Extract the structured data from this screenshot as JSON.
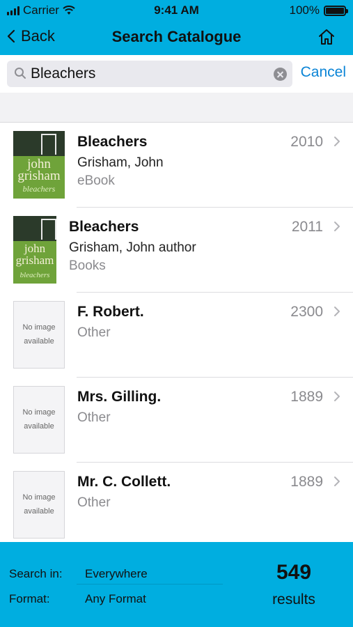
{
  "status_bar": {
    "carrier": "Carrier",
    "time": "9:41 AM",
    "battery": "100%",
    "icons": [
      "signal-icon",
      "wifi-icon",
      "battery-icon"
    ]
  },
  "nav": {
    "back_label": "Back",
    "title": "Search Catalogue",
    "icons": [
      "chevron-left-icon",
      "home-icon"
    ]
  },
  "search": {
    "query": "Bleachers",
    "cancel_label": "Cancel",
    "icons": [
      "search-icon",
      "clear-icon"
    ]
  },
  "results": [
    {
      "title": "Bleachers",
      "author": "Grisham, John",
      "format": "eBook",
      "year": "2010",
      "cover": {
        "type": "image",
        "lines": [
          "john",
          "grisham",
          "bleachers"
        ]
      }
    },
    {
      "title": "Bleachers",
      "author": "Grisham, John author",
      "format": "Books",
      "year": "2011",
      "cover": {
        "type": "image",
        "lines": [
          "john",
          "grisham",
          "bleachers"
        ]
      }
    },
    {
      "title": "F. Robert.",
      "author": "",
      "format": "Other",
      "year": "2300",
      "cover": {
        "type": "placeholder",
        "text": "No image available"
      }
    },
    {
      "title": "Mrs. Gilling.",
      "author": "",
      "format": "Other",
      "year": "1889",
      "cover": {
        "type": "placeholder",
        "text": "No image available"
      }
    },
    {
      "title": "Mr. C. Collett.",
      "author": "",
      "format": "Other",
      "year": "1889",
      "cover": {
        "type": "placeholder",
        "text": "No image available"
      }
    }
  ],
  "footer": {
    "search_in_label": "Search in:",
    "search_in_value": "Everywhere",
    "format_label": "Format:",
    "format_value": "Any Format",
    "count": "549",
    "count_label": "results"
  },
  "colors": {
    "accent": "#00aee0",
    "link": "#0a84d6",
    "secondary_text": "#8a8a8e"
  }
}
